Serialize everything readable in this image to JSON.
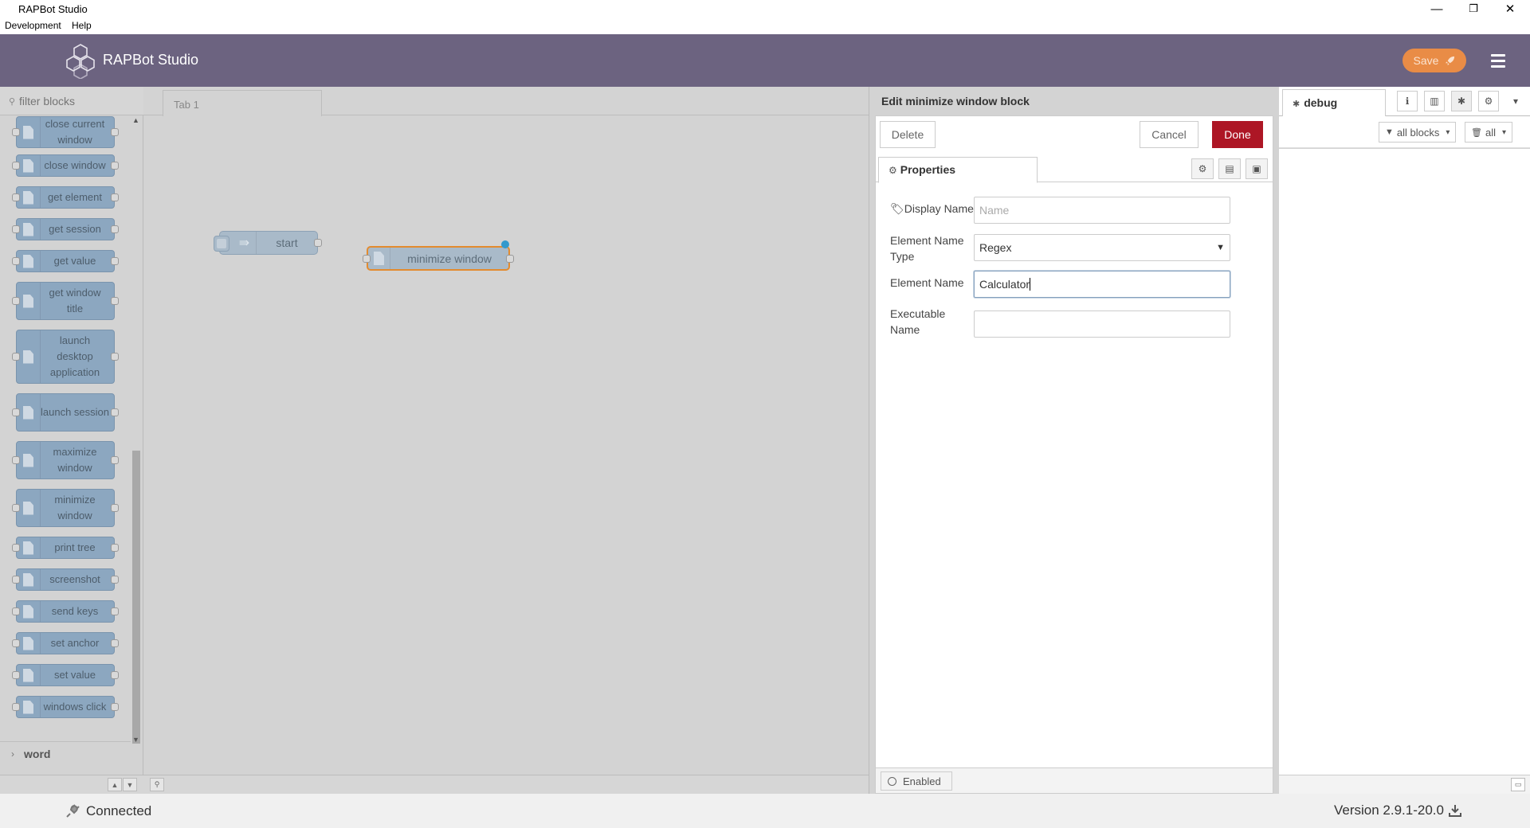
{
  "window": {
    "title": "RAPBot Studio",
    "minimize": "—",
    "restore": "❐",
    "close": "✕"
  },
  "menubar": {
    "development": "Development",
    "help": "Help"
  },
  "header": {
    "app_name": "RAPBot Studio",
    "save_label": "Save"
  },
  "palette": {
    "filter_placeholder": "filter blocks",
    "items": [
      {
        "label": "close current window"
      },
      {
        "label": "close window"
      },
      {
        "label": "get element"
      },
      {
        "label": "get session"
      },
      {
        "label": "get value"
      },
      {
        "label": "get window title"
      },
      {
        "label": "launch desktop application"
      },
      {
        "label": "launch session"
      },
      {
        "label": "maximize window"
      },
      {
        "label": "minimize window"
      },
      {
        "label": "print tree"
      },
      {
        "label": "screenshot"
      },
      {
        "label": "send keys"
      },
      {
        "label": "set anchor"
      },
      {
        "label": "set value"
      },
      {
        "label": "windows click"
      }
    ],
    "category_word": "word"
  },
  "workspace": {
    "tab_label": "Tab 1",
    "nodes": {
      "start": "start",
      "minimize": "minimize window"
    }
  },
  "tray": {
    "title": "Edit minimize window block",
    "delete_label": "Delete",
    "cancel_label": "Cancel",
    "done_label": "Done",
    "properties_tab": "Properties",
    "fields": {
      "display_name_label": "Display Name",
      "display_name_placeholder": "Name",
      "element_name_type_label": "Element Name Type",
      "element_name_type_value": "Regex",
      "element_name_label": "Element Name",
      "element_name_value": "Calculator",
      "executable_name_label": "Executable Name",
      "executable_name_value": ""
    },
    "enabled_label": "Enabled"
  },
  "sidebar": {
    "debug_tab": "debug",
    "filter_all_blocks": "all blocks",
    "clear_all": "all"
  },
  "status": {
    "connection": "Connected",
    "version": "Version 2.9.1-20.0"
  },
  "colors": {
    "header_bg": "#6c6380",
    "save_btn": "#e98c46",
    "done_btn": "#ad1625",
    "node_fill": "#8ca7c0",
    "selected_node_border": "#e38b2f"
  }
}
